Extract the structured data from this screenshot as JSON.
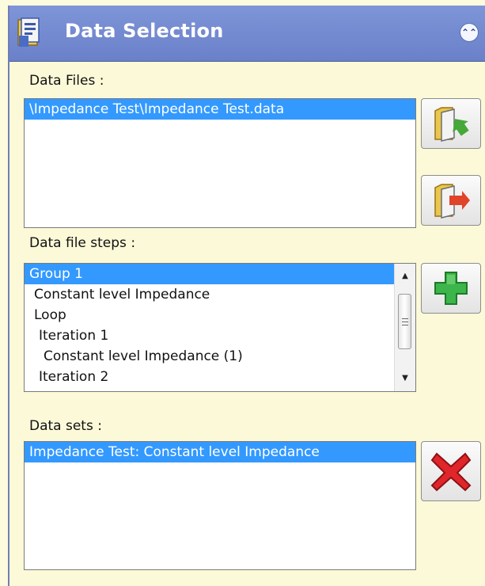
{
  "header": {
    "title": "Data Selection",
    "collapse_glyph": "⌃"
  },
  "data_files": {
    "label": "Data Files :",
    "items": [
      "\\Impedance Test\\Impedance Test.data"
    ]
  },
  "data_file_steps": {
    "label": "Data file steps :",
    "items": [
      "Group 1",
      " Constant level Impedance",
      " Loop",
      "  Iteration 1",
      "   Constant level Impedance (1)",
      "  Iteration 2"
    ]
  },
  "data_sets": {
    "label": "Data sets :",
    "items": [
      "Impedance Test: Constant level Impedance"
    ]
  },
  "icons": {
    "title": "data-selection-icon",
    "add_file": "folder-add-icon",
    "remove_file": "folder-remove-icon",
    "add_step": "plus-icon",
    "remove_set": "delete-x-icon"
  },
  "colors": {
    "header": "#7088d0",
    "panel_bg": "#fcf9d8",
    "selection": "#3399ff",
    "add_green": "#3cb54a",
    "delete_red": "#e0262a"
  }
}
